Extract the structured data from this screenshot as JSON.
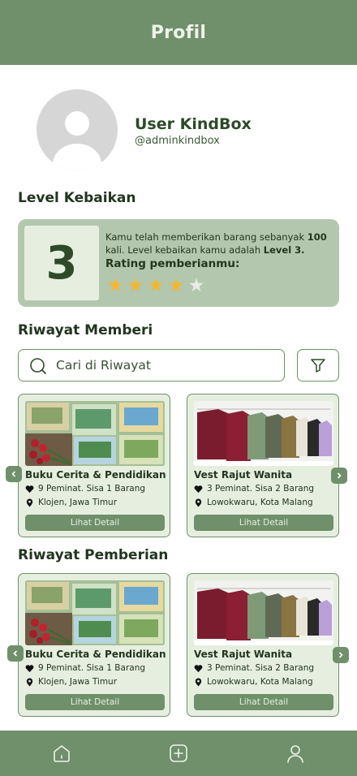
{
  "header": {
    "title": "Profil"
  },
  "profile": {
    "name": "User KindBox",
    "handle": "@adminkindbox"
  },
  "level": {
    "section_title": "Level Kebaikan",
    "number": "3",
    "text_prefix": "Kamu telah memberikan barang sebanyak ",
    "count": "100",
    "text_middle": " kali. Level kebaikan kamu adalah ",
    "level_label": "Level 3.",
    "rating_label": "Rating pemberianmu:",
    "rating": 4,
    "rating_max": 5
  },
  "riwayat_memberi": {
    "section_title": "Riwayat Memberi",
    "search_placeholder": "Cari di Riwayat",
    "cards": [
      {
        "title": "Buku Cerita & Pendidikan",
        "interest": "9 Peminat. Sisa 1 Barang",
        "location": "Klojen, Jawa Timur",
        "button": "Lihat Detail",
        "image": "books"
      },
      {
        "title": "Vest Rajut Wanita",
        "interest": "3 Peminat. Sisa 2 Barang",
        "location": "Lowokwaru, Kota Malang",
        "button": "Lihat Detail",
        "image": "vest"
      }
    ]
  },
  "riwayat_pemberian": {
    "section_title": "Riwayat Pemberian",
    "cards": [
      {
        "title": "Buku Cerita & Pendidikan",
        "interest": "9 Peminat. Sisa 1 Barang",
        "location": "Klojen, Jawa Timur",
        "button": "Lihat Detail",
        "image": "books"
      },
      {
        "title": "Vest Rajut Wanita",
        "interest": "3 Peminat. Sisa 2 Barang",
        "location": "Lowokwaru, Kota Malang",
        "button": "Lihat Detail",
        "image": "vest"
      }
    ]
  },
  "bottom_nav": [
    "home-icon",
    "add-icon",
    "user-icon"
  ],
  "colors": {
    "primary": "#6f906a",
    "card_bg": "#e6efdf",
    "level_bg": "#b3c7ae",
    "star": "#f4b731",
    "text_dark": "#22361f"
  }
}
